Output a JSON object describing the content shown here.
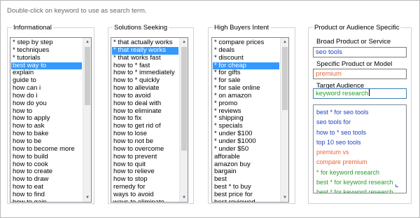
{
  "hint": "Double-click on keyword to use as search term.",
  "informational": {
    "title": "Informational",
    "items": [
      "* step by step",
      "* techniques",
      "* tutorials",
      "best way to",
      "explain",
      "guide to",
      "how can i",
      "how do i",
      "how do you",
      "how to",
      "how to apply",
      "how to ask",
      "how to bake",
      "how to be",
      "how to become more",
      "how to build",
      "how to cook",
      "how to create",
      "how to draw",
      "how to eat",
      "how to find",
      "how to gain"
    ],
    "selected_index": 3
  },
  "solutions": {
    "title": "Solutions Seeking",
    "items": [
      "* that actually works",
      "* that really works",
      "* that works fast",
      "how to * fast",
      "how to * immediately",
      "how to * quickly",
      "how to alleviate",
      "how to avoid",
      "how to deal with",
      "how to eliminate",
      "how to fix",
      "how to get rid of",
      "how to lose",
      "how to not be",
      "how to overcome",
      "how to prevent",
      "how to quit",
      "how to relieve",
      "how to stop",
      "remedy for",
      "ways to avoid",
      "ways to eliminate"
    ],
    "selected_index": 1
  },
  "buyers": {
    "title": "High Buyers Intent",
    "items": [
      "* compare prices",
      "* deals",
      "* discount",
      "* for cheap",
      "* for gifts",
      "* for sale",
      "* for sale online",
      "* on amazon",
      "* promo",
      "* reviews",
      "* shipping",
      "* specials",
      "* under $100",
      "* under $1000",
      "* under $50",
      "afforable",
      "amazon buy",
      "bargain",
      "best",
      "best * to buy",
      "best price for",
      "best reviewed"
    ],
    "selected_index": 3
  },
  "product": {
    "title": "Product or Audience Specific",
    "broad_label": "Broad Product or Service",
    "broad_value": "seo tools",
    "specific_label": "Specific Product or Model",
    "specific_value": "premium",
    "audience_label": "Target Audience",
    "audience_value": "keyword research",
    "results": [
      {
        "text": "best * for seo tools",
        "color": "#1f3fbf"
      },
      {
        "text": "seo tools for",
        "color": "#1f3fbf"
      },
      {
        "text": "how to * seo tools",
        "color": "#1f3fbf"
      },
      {
        "text": "top 10 seo tools",
        "color": "#1f3fbf"
      },
      {
        "text": "premium vs",
        "color": "#e8643c"
      },
      {
        "text": "compare premium",
        "color": "#e8643c"
      },
      {
        "text": "* for keyword research",
        "color": "#2e9a2e"
      },
      {
        "text": "best * for keyword research",
        "color": "#2e9a2e"
      },
      {
        "text": "best * for keyword research",
        "color": "#2e9a2e"
      }
    ]
  },
  "colors": {
    "selection": "#3399ff",
    "broad_text": "#1f3fbf",
    "specific_text": "#e8643c",
    "audience_text": "#2e9a2e"
  }
}
